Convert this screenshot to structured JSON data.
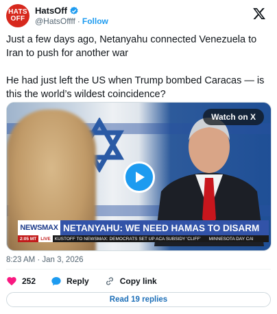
{
  "author": {
    "avatar_text_top": "HATS",
    "avatar_text_bottom": "OFF",
    "name": "HatsOff",
    "handle": "@HatsOffff",
    "separator": "·",
    "follow_label": "Follow"
  },
  "tweet": {
    "paragraph_1": "Just a few days ago, Netanyahu connected Venezuela to Iran to push for another war",
    "paragraph_2": "He had just left the US when Trump bombed Caracas — is this the world’s wildest coincidence?"
  },
  "video": {
    "watch_label": "Watch on X",
    "network_logo": "NEWSMAX",
    "headline": "NETANYAHU: WE NEED HAMAS TO DISARM",
    "ticker_time": "2:05 MT",
    "ticker_live": "LIVE",
    "ticker_text_1": "KUSTOFF TO NEWSMAX: DEMOCRATS SET UP ACA SUBSIDY 'CLIFF'",
    "ticker_text_2": "MINNESOTA DAY CAI"
  },
  "meta": {
    "timestamp": "8:23 AM · Jan 3, 2026"
  },
  "actions": {
    "likes_count": "252",
    "reply_label": "Reply",
    "copy_label": "Copy link"
  },
  "read_replies_label": "Read 19 replies",
  "colors": {
    "accent": "#1d9bf0",
    "like": "#f91880",
    "avatar": "#d7281d",
    "headline_bar": "#3253a8"
  },
  "icons": [
    "verified-badge-icon",
    "x-logo-icon",
    "play-icon",
    "heart-icon",
    "reply-bubble-icon",
    "link-icon"
  ]
}
